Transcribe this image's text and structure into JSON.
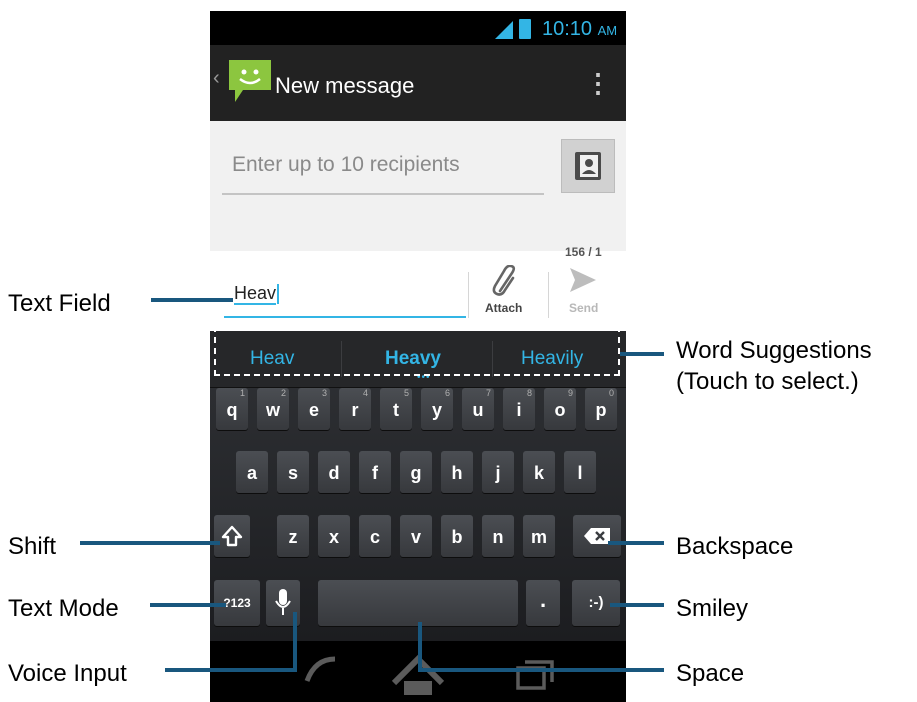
{
  "status_bar": {
    "time": "10:10",
    "ampm": "AM"
  },
  "action_bar": {
    "title": "New message",
    "overflow_glyph": "⋮"
  },
  "recipients": {
    "placeholder": "Enter up to 10 recipients"
  },
  "counter": "156 / 1",
  "compose": {
    "text": "Heav",
    "attach_label": "Attach",
    "send_label": "Send"
  },
  "suggestions": [
    "Heav",
    "Heavy",
    "Heavily"
  ],
  "keyboard": {
    "row1": [
      {
        "key": "q",
        "hint": "1"
      },
      {
        "key": "w",
        "hint": "2"
      },
      {
        "key": "e",
        "hint": "3"
      },
      {
        "key": "r",
        "hint": "4"
      },
      {
        "key": "t",
        "hint": "5"
      },
      {
        "key": "y",
        "hint": "6"
      },
      {
        "key": "u",
        "hint": "7"
      },
      {
        "key": "i",
        "hint": "8"
      },
      {
        "key": "o",
        "hint": "9"
      },
      {
        "key": "p",
        "hint": "0"
      }
    ],
    "row2": [
      "a",
      "s",
      "d",
      "f",
      "g",
      "h",
      "j",
      "k",
      "l"
    ],
    "row3": [
      "z",
      "x",
      "c",
      "v",
      "b",
      "n",
      "m"
    ],
    "mode_key": "?123",
    "period_key": ".",
    "smiley_key": ":-)"
  },
  "callouts": {
    "text_field": "Text Field",
    "word_suggestions": "Word Suggestions",
    "word_suggestions_hint": "(Touch to select.)",
    "shift": "Shift",
    "backspace": "Backspace",
    "text_mode": "Text Mode",
    "smiley": "Smiley",
    "voice_input": "Voice Input",
    "space": "Space"
  },
  "colors": {
    "accent": "#33b5e5",
    "callout_line": "#19577e",
    "keyboard_bg": "#2b2c30",
    "messaging_green": "#8cc63f"
  },
  "icons": [
    "signal-icon",
    "battery-icon",
    "back-chevron-icon",
    "messaging-app-icon",
    "overflow-menu-icon",
    "contact-picker-icon",
    "paperclip-icon",
    "send-icon",
    "shift-icon",
    "backspace-icon",
    "microphone-icon",
    "back-nav-icon",
    "home-nav-icon",
    "recent-apps-icon"
  ]
}
